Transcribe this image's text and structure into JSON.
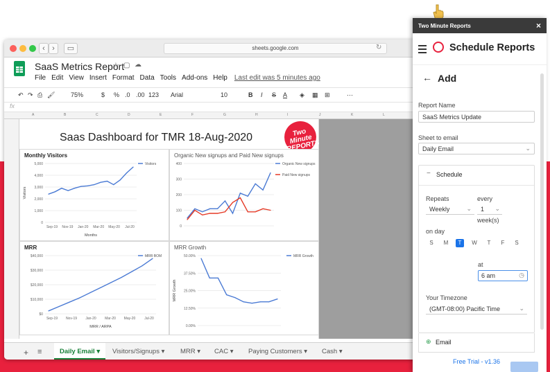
{
  "browser": {
    "url": "sheets.google.com"
  },
  "doc": {
    "title": "SaaS Metrics Report",
    "menu": [
      "File",
      "Edit",
      "View",
      "Insert",
      "Format",
      "Data",
      "Tools",
      "Add-ons",
      "Help"
    ],
    "last_edit": "Last edit was 5 minutes ago"
  },
  "toolbar": {
    "zoom": "75%",
    "currency": "$",
    "percent": "%",
    "dec_less": ".0",
    "dec_more": ".00",
    "number_format": "123",
    "font": "Arial",
    "font_size": "10",
    "bold": "B",
    "italic": "I",
    "strike": "S",
    "text_color": "A"
  },
  "formula_bar": {
    "label": "fx"
  },
  "columns": [
    "A",
    "B",
    "C",
    "D",
    "E",
    "F",
    "G",
    "H",
    "I",
    "J",
    "K",
    "L"
  ],
  "dashboard": {
    "title": "Saas Dashboard for TMR 18-Aug-2020",
    "badge_line1": "Two Minute",
    "badge_line2": "REPORTS"
  },
  "charts": {
    "visitors": {
      "title": "Monthly Visitors",
      "ylabel": "Visitors",
      "xlabel": "Months",
      "legend": "Visitors",
      "yticks": [
        "5,000",
        "4,000",
        "3,000",
        "2,000",
        "1,000",
        "0"
      ],
      "xticks": [
        "Sep-19",
        "Nov-19",
        "Jan-20",
        "Mar-20",
        "May-20",
        "Jul-20"
      ]
    },
    "signups": {
      "title": "Organic New signups and Paid New signups",
      "legend1": "Organic New signups",
      "legend2": "Paid New signups",
      "yticks": [
        "400",
        "300",
        "200",
        "100",
        "0"
      ]
    },
    "mrr": {
      "title": "MRR",
      "xlabel": "MRR / ARPA",
      "legend": "MRR BOM",
      "yticks": [
        "$40,000",
        "$30,000",
        "$20,000",
        "$10,000",
        "$0"
      ],
      "xticks": [
        "Sep-19",
        "Nov-19",
        "Jan-20",
        "Mar-20",
        "May-20",
        "Jul-20"
      ]
    },
    "growth": {
      "title": "MRR Growth",
      "ylabel": "MRR Growth",
      "legend": "MRR Growth",
      "yticks": [
        "50.00%",
        "37.50%",
        "25.00%",
        "12.50%",
        "0.00%"
      ]
    }
  },
  "chart_data": [
    {
      "type": "line",
      "title": "Monthly Visitors",
      "xlabel": "Months",
      "ylabel": "Visitors",
      "ylim": [
        0,
        5000
      ],
      "series": [
        {
          "name": "Visitors",
          "values": [
            2400,
            2600,
            2900,
            2700,
            2900,
            3050,
            3100,
            3200,
            3400,
            3500,
            3200,
            3600,
            4200,
            4700
          ]
        }
      ]
    },
    {
      "type": "line",
      "title": "Organic New signups and Paid New signups",
      "ylim": [
        0,
        400
      ],
      "series": [
        {
          "name": "Organic New signups",
          "values": [
            50,
            110,
            90,
            110,
            110,
            160,
            80,
            210,
            190,
            270,
            230,
            340
          ]
        },
        {
          "name": "Paid New signups",
          "values": [
            40,
            100,
            70,
            80,
            80,
            90,
            150,
            180,
            90,
            90,
            110,
            100
          ]
        }
      ]
    },
    {
      "type": "line",
      "title": "MRR",
      "xlabel": "MRR / ARPA",
      "ylim": [
        0,
        40000
      ],
      "series": [
        {
          "name": "MRR BOM",
          "values": [
            2000,
            5000,
            8000,
            11000,
            14500,
            18000,
            21500,
            25000,
            29000,
            33000,
            38000
          ]
        }
      ]
    },
    {
      "type": "line",
      "title": "MRR Growth",
      "ylabel": "MRR Growth",
      "ylim": [
        0,
        50
      ],
      "series": [
        {
          "name": "MRR Growth",
          "values": [
            48,
            34,
            34,
            22,
            20,
            17,
            16,
            17,
            17,
            19
          ]
        }
      ]
    }
  ],
  "sheets": [
    "Daily Email",
    "Visitors/Signups",
    "MRR",
    "CAC",
    "Paying Customers",
    "Cash"
  ],
  "panel": {
    "window_title": "Two Minute Reports",
    "close": "×",
    "title": "Schedule Reports",
    "back": "←",
    "subtitle": "Add",
    "report_name_label": "Report Name",
    "report_name_value": "SaaS Metrics Update",
    "sheet_label": "Sheet to email",
    "sheet_value": "Daily Email",
    "schedule_label": "Schedule",
    "repeats_label": "Repeats",
    "repeats_value": "Weekly",
    "every_label": "every",
    "every_value": "1",
    "every_unit": "week(s)",
    "onday_label": "on day",
    "days": [
      "S",
      "M",
      "T",
      "W",
      "T",
      "F",
      "S"
    ],
    "selected_day": 2,
    "at_label": "at",
    "at_value": "6 am",
    "tz_label": "Your Timezone",
    "tz_value": "(GMT-08:00) Pacific Time",
    "email_label": "Email",
    "footer": "Free Trial - v1.36"
  },
  "colors": {
    "accent_red": "#e8213d",
    "sheets_green": "#188038",
    "series_blue": "#4a7ad4",
    "series_red": "#e53925"
  }
}
